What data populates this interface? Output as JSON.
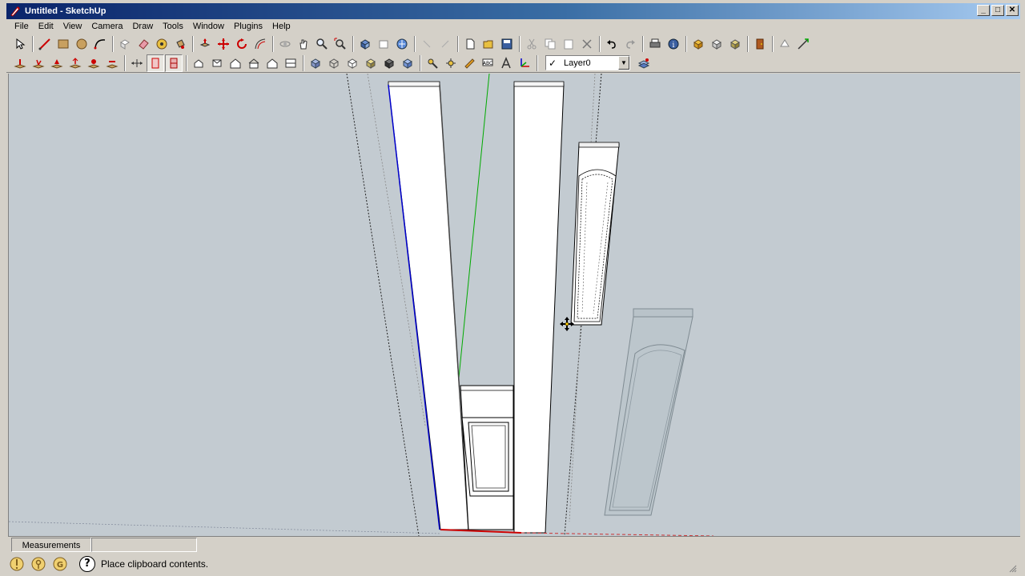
{
  "window": {
    "title": "Untitled - SketchUp",
    "minimize": "_",
    "maximize": "□",
    "close": "✕"
  },
  "menu": {
    "items": [
      "File",
      "Edit",
      "View",
      "Camera",
      "Draw",
      "Tools",
      "Window",
      "Plugins",
      "Help"
    ]
  },
  "toolbar1": {
    "icons": [
      "select-icon",
      "line-icon",
      "rectangle-icon",
      "circle-icon",
      "arc-icon",
      "make-component-icon",
      "eraser-icon",
      "tape-measure-icon",
      "paint-bucket-icon",
      "push-pull-icon",
      "move-icon",
      "rotate-icon",
      "offset-icon",
      "orbit-icon",
      "pan-icon",
      "zoom-icon",
      "zoom-extents-icon",
      "previous-view-icon",
      "next-view-icon",
      "get-models-icon",
      "new-icon",
      "open-icon",
      "save-icon",
      "cut-icon",
      "copy-icon",
      "paste-icon",
      "delete-icon",
      "undo-icon",
      "redo-icon",
      "print-icon",
      "model-info-icon",
      "component-icon",
      "group-icon",
      "solid-icon",
      "door-icon",
      "section-icon",
      "follow-me-icon"
    ]
  },
  "toolbar2": {
    "icons": [
      "add-location-icon",
      "terrain-icon",
      "stamp-icon",
      "drape-icon",
      "smoove-icon",
      "flip-edge-icon",
      "section-plane-icon",
      "section-display-icon",
      "section-cut-icon",
      "iso-view-icon",
      "top-view-icon",
      "front-view-icon",
      "right-view-icon",
      "back-view-icon",
      "left-view-icon",
      "xray-icon",
      "wireframe-icon",
      "hidden-line-icon",
      "shaded-icon",
      "shaded-textures-icon",
      "monochrome-icon",
      "walk-icon",
      "look-around-icon",
      "position-camera-icon",
      "text-icon",
      "3d-text-icon",
      "axes-icon",
      "layer-manager-icon"
    ],
    "layer": {
      "checked": "✓",
      "name": "Layer0"
    }
  },
  "measurements": {
    "label": "Measurements",
    "value": ""
  },
  "status": {
    "help_icon": "?",
    "message": "Place clipboard contents."
  },
  "colors": {
    "viewport_bg": "#c3cbd1",
    "axis_green": "#00aa00",
    "axis_blue": "#0000cc",
    "axis_red": "#cc0000",
    "titlebar": "#0a246a"
  }
}
